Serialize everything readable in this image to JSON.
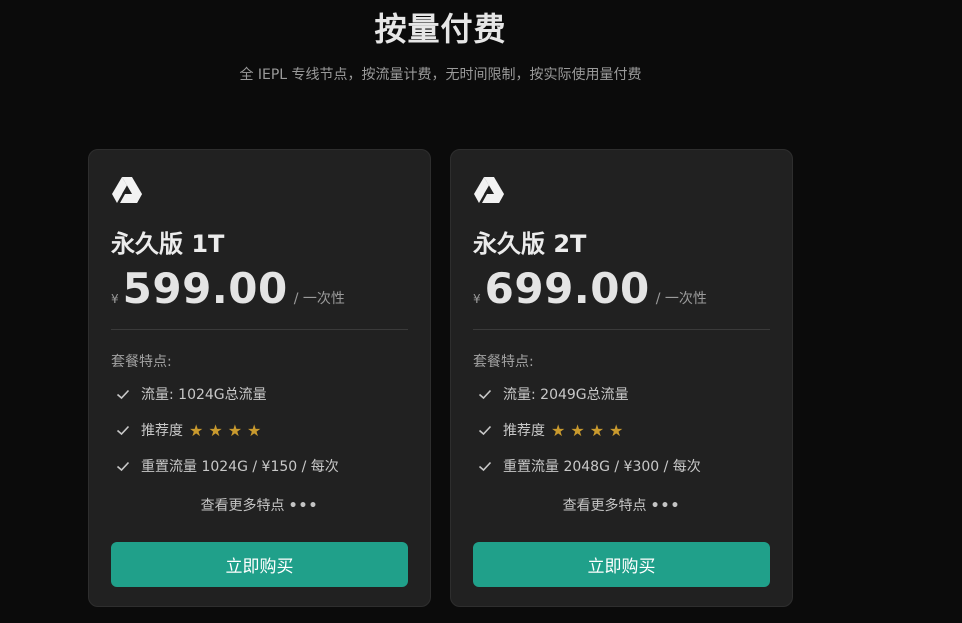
{
  "header": {
    "title": "按量付费",
    "subtitle": "全 IEPL 专线节点，按流量计费，无时间限制，按实际使用量付费"
  },
  "plans": [
    {
      "name": "永久版 1T",
      "currency": "¥",
      "price": "599.00",
      "period": "/  一次性",
      "features_heading": "套餐特点:",
      "features": [
        "流量: 1024G总流量",
        "推荐度",
        "重置流量 1024G / ¥150 / 每次"
      ],
      "rating_stars": 4,
      "stars_text": "★★★★",
      "more_label": "查看更多特点",
      "more_dots": "•••",
      "buy_label": "立即购买",
      "logo_icon": "drive-triangle-icon"
    },
    {
      "name": "永久版 2T",
      "currency": "¥",
      "price": "699.00",
      "period": "/  一次性",
      "features_heading": "套餐特点:",
      "features": [
        "流量: 2049G总流量",
        "推荐度",
        "重置流量 2048G / ¥300 / 每次"
      ],
      "rating_stars": 4,
      "stars_text": "★★★★",
      "more_label": "查看更多特点",
      "more_dots": "•••",
      "buy_label": "立即购买",
      "logo_icon": "drive-triangle-icon"
    }
  ],
  "colors": {
    "background": "#0b0b0b",
    "card": "#212121",
    "accent": "#20a08a",
    "star": "#c99a2e"
  }
}
